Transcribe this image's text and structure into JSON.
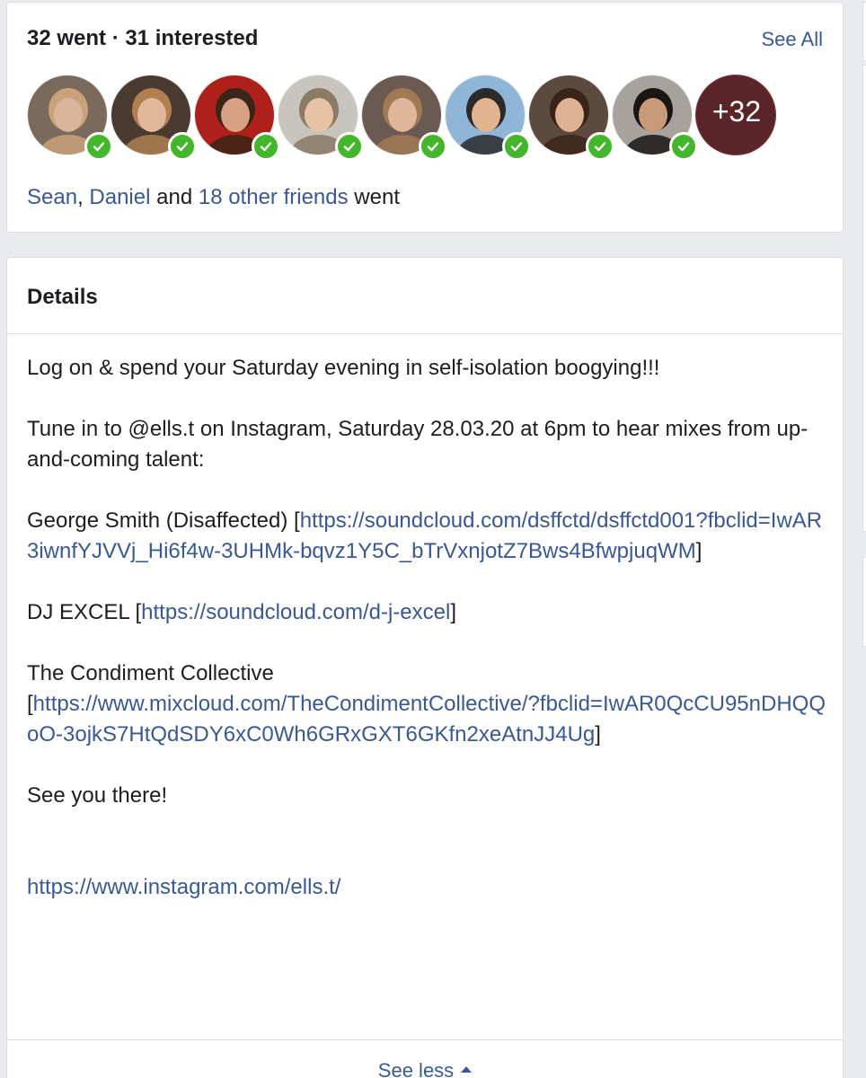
{
  "going": {
    "stats": "32 went · 31 interested",
    "see_all": "See All",
    "avatars": [
      {
        "bg": "#7a6a5c",
        "skin": "#d9b59b",
        "hair": "#c9a27a"
      },
      {
        "bg": "#4a3a30",
        "skin": "#e2b89a",
        "hair": "#b08050"
      },
      {
        "bg": "#b0201a",
        "skin": "#d8a282",
        "hair": "#3a2618"
      },
      {
        "bg": "#c8c4be",
        "skin": "#e7c3a6",
        "hair": "#8a7a66"
      },
      {
        "bg": "#6a5a52",
        "skin": "#dfb59c",
        "hair": "#a07a54"
      },
      {
        "bg": "#8fb6d6",
        "skin": "#e3b58e",
        "hair": "#2a2a2a"
      },
      {
        "bg": "#5c4a3e",
        "skin": "#e0b294",
        "hair": "#3a2418"
      },
      {
        "bg": "#a8a29c",
        "skin": "#c99a78",
        "hair": "#1a1614"
      }
    ],
    "more": {
      "label": "+32",
      "bg": "#8a3a40"
    },
    "friends": {
      "name1": "Sean",
      "sep1": ",",
      "name2": "Daniel",
      "and": "and",
      "others": "18 other friends",
      "went": "went"
    }
  },
  "details": {
    "title": "Details",
    "line1": "Log on & spend your Saturday evening in self-isolation boogying!!!",
    "line2": "Tune in to @ells.t on Instagram, Saturday 28.03.20 at 6pm to hear mixes from up-and-coming talent:",
    "artist1": {
      "name": "George Smith (Disaffected)",
      "url": "https://soundcloud.com/dsffctd/dsffctd001?fbclid=IwAR3iwnfYJVVj_Hi6f4w-3UHMk-bqvz1Y5C_bTrVxnjotZ7Bws4BfwpjuqWM"
    },
    "artist2": {
      "name": "DJ EXCEL",
      "url": "https://soundcloud.com/d-j-excel"
    },
    "artist3": {
      "name": "The Condiment Collective",
      "url": "https://www.mixcloud.com/TheCondimentCollective/?fbclid=IwAR0QcCU95nDHQQoO-3ojkS7HtQdSDY6xC0Wh6GRxGXT6GKfn2xeAtnJJ4Ug"
    },
    "line_end": "See you there!",
    "instagram": "https://www.instagram.com/ells.t/",
    "see_less": "See less"
  },
  "colors": {
    "link": "#385898",
    "check": "#42b72a"
  }
}
